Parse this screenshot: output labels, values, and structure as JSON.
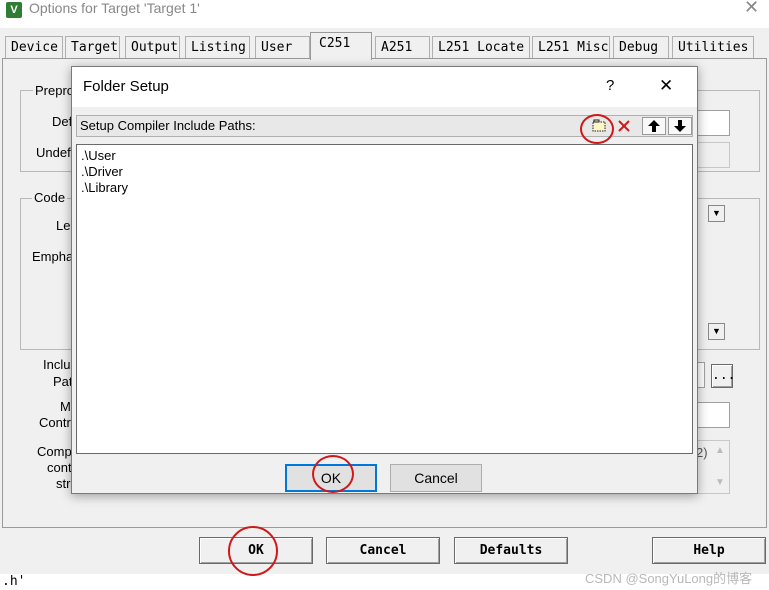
{
  "window": {
    "title": "Options for Target 'Target 1'",
    "icon_letter": "V",
    "close_glyph": "✕"
  },
  "tabs": [
    {
      "label": "Device"
    },
    {
      "label": "Target"
    },
    {
      "label": "Output"
    },
    {
      "label": "Listing"
    },
    {
      "label": "User"
    },
    {
      "label": "C251"
    },
    {
      "label": "A251"
    },
    {
      "label": "L251 Locate"
    },
    {
      "label": "L251 Misc"
    },
    {
      "label": "Debug"
    },
    {
      "label": "Utilities"
    }
  ],
  "background_labels": {
    "preprocessor": "Prepro",
    "define": "Def",
    "undefine": "Undef",
    "code": "Code",
    "level": "Le",
    "emphasis": "Empha",
    "include_1": "Inclu",
    "include_2": "Pat",
    "misc_1": "M",
    "misc_2": "Contr",
    "compiler_1": "Comp",
    "compiler_2": "cont",
    "compiler_3": "stri",
    "scroll_fragment": "2)",
    "ellipsis_btn": "..."
  },
  "dialog": {
    "title": "Folder Setup",
    "help_glyph": "?",
    "close_glyph": "✕",
    "toolbar_label": "Setup Compiler Include Paths:",
    "toolbar_icons": [
      "new-folder-icon",
      "delete-icon",
      "move-up-icon",
      "move-down-icon"
    ],
    "paths": [
      ".\\User",
      ".\\Driver",
      ".\\Library"
    ],
    "ok_label": "OK",
    "cancel_label": "Cancel"
  },
  "bottom_buttons": {
    "ok": "OK",
    "cancel": "Cancel",
    "defaults": "Defaults",
    "help": "Help"
  },
  "bottom_left_fragment": ".h'",
  "watermark": "CSDN @SongYuLong的博客",
  "colors": {
    "annotation_red": "#d01818",
    "app_icon": "#2e7d32"
  }
}
